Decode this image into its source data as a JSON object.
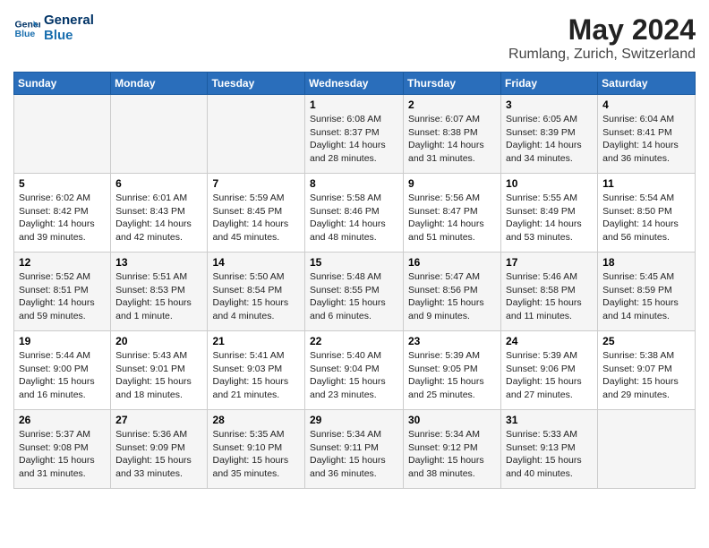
{
  "header": {
    "logo_line1": "General",
    "logo_line2": "Blue",
    "month_year": "May 2024",
    "location": "Rumlang, Zurich, Switzerland"
  },
  "days_of_week": [
    "Sunday",
    "Monday",
    "Tuesday",
    "Wednesday",
    "Thursday",
    "Friday",
    "Saturday"
  ],
  "weeks": [
    [
      {
        "day": "",
        "info": ""
      },
      {
        "day": "",
        "info": ""
      },
      {
        "day": "",
        "info": ""
      },
      {
        "day": "1",
        "info": "Sunrise: 6:08 AM\nSunset: 8:37 PM\nDaylight: 14 hours\nand 28 minutes."
      },
      {
        "day": "2",
        "info": "Sunrise: 6:07 AM\nSunset: 8:38 PM\nDaylight: 14 hours\nand 31 minutes."
      },
      {
        "day": "3",
        "info": "Sunrise: 6:05 AM\nSunset: 8:39 PM\nDaylight: 14 hours\nand 34 minutes."
      },
      {
        "day": "4",
        "info": "Sunrise: 6:04 AM\nSunset: 8:41 PM\nDaylight: 14 hours\nand 36 minutes."
      }
    ],
    [
      {
        "day": "5",
        "info": "Sunrise: 6:02 AM\nSunset: 8:42 PM\nDaylight: 14 hours\nand 39 minutes."
      },
      {
        "day": "6",
        "info": "Sunrise: 6:01 AM\nSunset: 8:43 PM\nDaylight: 14 hours\nand 42 minutes."
      },
      {
        "day": "7",
        "info": "Sunrise: 5:59 AM\nSunset: 8:45 PM\nDaylight: 14 hours\nand 45 minutes."
      },
      {
        "day": "8",
        "info": "Sunrise: 5:58 AM\nSunset: 8:46 PM\nDaylight: 14 hours\nand 48 minutes."
      },
      {
        "day": "9",
        "info": "Sunrise: 5:56 AM\nSunset: 8:47 PM\nDaylight: 14 hours\nand 51 minutes."
      },
      {
        "day": "10",
        "info": "Sunrise: 5:55 AM\nSunset: 8:49 PM\nDaylight: 14 hours\nand 53 minutes."
      },
      {
        "day": "11",
        "info": "Sunrise: 5:54 AM\nSunset: 8:50 PM\nDaylight: 14 hours\nand 56 minutes."
      }
    ],
    [
      {
        "day": "12",
        "info": "Sunrise: 5:52 AM\nSunset: 8:51 PM\nDaylight: 14 hours\nand 59 minutes."
      },
      {
        "day": "13",
        "info": "Sunrise: 5:51 AM\nSunset: 8:53 PM\nDaylight: 15 hours\nand 1 minute."
      },
      {
        "day": "14",
        "info": "Sunrise: 5:50 AM\nSunset: 8:54 PM\nDaylight: 15 hours\nand 4 minutes."
      },
      {
        "day": "15",
        "info": "Sunrise: 5:48 AM\nSunset: 8:55 PM\nDaylight: 15 hours\nand 6 minutes."
      },
      {
        "day": "16",
        "info": "Sunrise: 5:47 AM\nSunset: 8:56 PM\nDaylight: 15 hours\nand 9 minutes."
      },
      {
        "day": "17",
        "info": "Sunrise: 5:46 AM\nSunset: 8:58 PM\nDaylight: 15 hours\nand 11 minutes."
      },
      {
        "day": "18",
        "info": "Sunrise: 5:45 AM\nSunset: 8:59 PM\nDaylight: 15 hours\nand 14 minutes."
      }
    ],
    [
      {
        "day": "19",
        "info": "Sunrise: 5:44 AM\nSunset: 9:00 PM\nDaylight: 15 hours\nand 16 minutes."
      },
      {
        "day": "20",
        "info": "Sunrise: 5:43 AM\nSunset: 9:01 PM\nDaylight: 15 hours\nand 18 minutes."
      },
      {
        "day": "21",
        "info": "Sunrise: 5:41 AM\nSunset: 9:03 PM\nDaylight: 15 hours\nand 21 minutes."
      },
      {
        "day": "22",
        "info": "Sunrise: 5:40 AM\nSunset: 9:04 PM\nDaylight: 15 hours\nand 23 minutes."
      },
      {
        "day": "23",
        "info": "Sunrise: 5:39 AM\nSunset: 9:05 PM\nDaylight: 15 hours\nand 25 minutes."
      },
      {
        "day": "24",
        "info": "Sunrise: 5:39 AM\nSunset: 9:06 PM\nDaylight: 15 hours\nand 27 minutes."
      },
      {
        "day": "25",
        "info": "Sunrise: 5:38 AM\nSunset: 9:07 PM\nDaylight: 15 hours\nand 29 minutes."
      }
    ],
    [
      {
        "day": "26",
        "info": "Sunrise: 5:37 AM\nSunset: 9:08 PM\nDaylight: 15 hours\nand 31 minutes."
      },
      {
        "day": "27",
        "info": "Sunrise: 5:36 AM\nSunset: 9:09 PM\nDaylight: 15 hours\nand 33 minutes."
      },
      {
        "day": "28",
        "info": "Sunrise: 5:35 AM\nSunset: 9:10 PM\nDaylight: 15 hours\nand 35 minutes."
      },
      {
        "day": "29",
        "info": "Sunrise: 5:34 AM\nSunset: 9:11 PM\nDaylight: 15 hours\nand 36 minutes."
      },
      {
        "day": "30",
        "info": "Sunrise: 5:34 AM\nSunset: 9:12 PM\nDaylight: 15 hours\nand 38 minutes."
      },
      {
        "day": "31",
        "info": "Sunrise: 5:33 AM\nSunset: 9:13 PM\nDaylight: 15 hours\nand 40 minutes."
      },
      {
        "day": "",
        "info": ""
      }
    ]
  ]
}
